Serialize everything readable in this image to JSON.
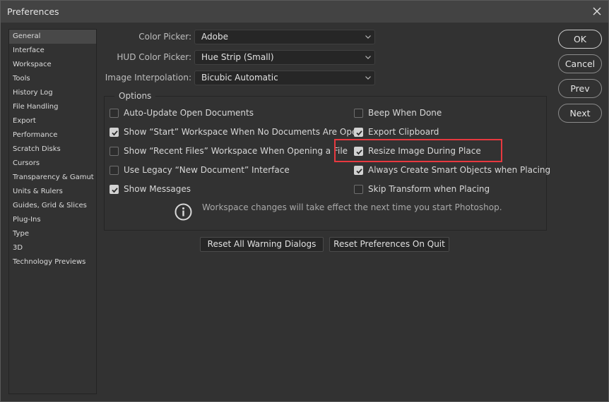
{
  "window": {
    "title": "Preferences"
  },
  "sidebar": {
    "items": [
      {
        "label": "General",
        "active": true
      },
      {
        "label": "Interface"
      },
      {
        "label": "Workspace"
      },
      {
        "label": "Tools"
      },
      {
        "label": "History Log"
      },
      {
        "label": "File Handling"
      },
      {
        "label": "Export"
      },
      {
        "label": "Performance"
      },
      {
        "label": "Scratch Disks"
      },
      {
        "label": "Cursors"
      },
      {
        "label": "Transparency & Gamut"
      },
      {
        "label": "Units & Rulers"
      },
      {
        "label": "Guides, Grid & Slices"
      },
      {
        "label": "Plug-Ins"
      },
      {
        "label": "Type"
      },
      {
        "label": "3D"
      },
      {
        "label": "Technology Previews"
      }
    ]
  },
  "form": {
    "color_picker": {
      "label": "Color Picker:",
      "value": "Adobe"
    },
    "hud_color_picker": {
      "label": "HUD Color Picker:",
      "value": "Hue Strip (Small)"
    },
    "image_interpolation": {
      "label": "Image Interpolation:",
      "value": "Bicubic Automatic"
    }
  },
  "options": {
    "title": "Options",
    "left": [
      {
        "label": "Auto-Update Open Documents",
        "checked": false
      },
      {
        "label": "Show “Start” Workspace When No Documents Are Open",
        "checked": true
      },
      {
        "label": "Show “Recent Files” Workspace When Opening a File",
        "checked": false
      },
      {
        "label": "Use Legacy “New Document” Interface",
        "checked": false
      },
      {
        "label": "Show Messages",
        "checked": true
      }
    ],
    "right": [
      {
        "label": "Beep When Done",
        "checked": false
      },
      {
        "label": "Export Clipboard",
        "checked": true
      },
      {
        "label": "Resize Image During Place",
        "checked": true,
        "highlighted": true
      },
      {
        "label": "Always Create Smart Objects when Placing",
        "checked": true
      },
      {
        "label": "Skip Transform when Placing",
        "checked": false
      }
    ],
    "info_text": "Workspace changes will take effect the next time you start Photoshop."
  },
  "buttons": {
    "reset_warnings": "Reset All Warning Dialogs",
    "reset_prefs": "Reset Preferences On Quit",
    "ok": "OK",
    "cancel": "Cancel",
    "prev": "Prev",
    "next": "Next"
  },
  "colors": {
    "highlight": "#e8393f",
    "background": "#323232",
    "titlebar": "#434343"
  }
}
